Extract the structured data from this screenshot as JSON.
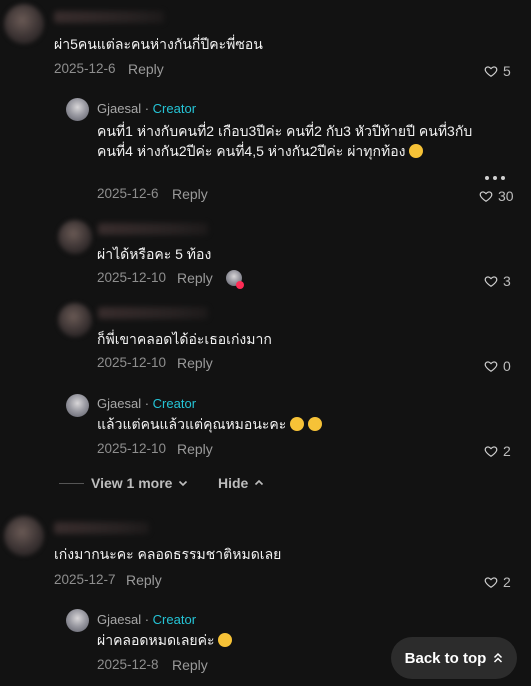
{
  "comments": [
    {
      "text": "ผ่า5คนแต่ละคนห่างกันกี่ปีคะพี่ซอน",
      "date": "2025-12-6",
      "reply_label": "Reply",
      "likes": "5"
    },
    {
      "author": "Gjaesal",
      "sep": "·",
      "badge": "Creator",
      "text": "คนที่1 ห่างกับคนที่2 เกือบ3ปีค่ะ คนที่2 กับ3 หัวปีท้ายปี คนที่3กับคนที่4 ห่างกัน2ปีค่ะ คนที่4,5 ห่างกัน2ปีค่ะ ผ่าทุกท้อง",
      "date": "2025-12-6",
      "reply_label": "Reply",
      "likes": "30"
    },
    {
      "text": "ผ่าได้หรือคะ 5 ท้อง",
      "date": "2025-12-10",
      "reply_label": "Reply",
      "likes": "3"
    },
    {
      "text": "ก็พี่เขาคลอดได้อ่ะเธอเก่งมาก",
      "date": "2025-12-10",
      "reply_label": "Reply",
      "likes": "0"
    },
    {
      "author": "Gjaesal",
      "sep": "·",
      "badge": "Creator",
      "text": "แล้วแต่คนแล้วแต่คุณหมอนะคะ",
      "date": "2025-12-10",
      "reply_label": "Reply",
      "likes": "2"
    },
    {
      "text": "เก่งมากนะคะ คลอดธรรมชาติหมดเลย",
      "date": "2025-12-7",
      "reply_label": "Reply",
      "likes": "2"
    },
    {
      "author": "Gjaesal",
      "sep": "·",
      "badge": "Creator",
      "text": "ผ่าคลอดหมดเลยค่ะ",
      "date": "2025-12-8",
      "reply_label": "Reply"
    }
  ],
  "controls": {
    "view_more": "View 1 more",
    "hide": "Hide",
    "back_to_top": "Back to top"
  },
  "icons": {
    "like": "heart-outline-icon",
    "more": "more-horizontal-icon",
    "chevron_down": "chevron-down-icon",
    "chevron_up": "chevron-up-icon",
    "back_top": "double-chevron-up-icon"
  },
  "colors": {
    "background": "#121212",
    "creator_badge": "#25c4d6",
    "back_to_top_bg": "#2c2c2c"
  }
}
